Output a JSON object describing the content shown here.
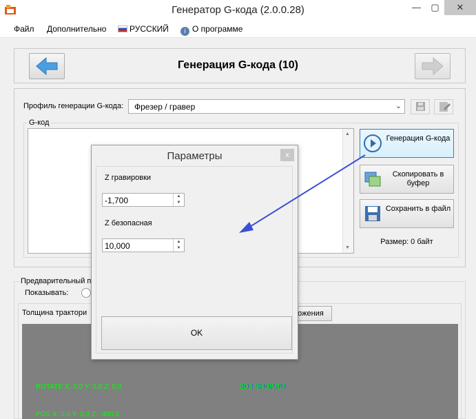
{
  "window": {
    "title": "Генератор G-кода (2.0.0.28)",
    "minimize": "—",
    "maximize": "▢",
    "close": "✕"
  },
  "menu": {
    "file": "Файл",
    "extra": "Дополнительно",
    "language": "РУССКИЙ",
    "about": "О программе"
  },
  "header": {
    "title": "Генерация G-кода (10)"
  },
  "profile": {
    "label": "Профиль генерации G-кода:",
    "selected": "Фрезер / гравер"
  },
  "gcode": {
    "group_label": "G-код",
    "generate_button": "Генерация G-кода",
    "copy_button": "Скопировать в буфер",
    "save_button": "Сохранить в файл",
    "size_label": "Размер: 0 байт"
  },
  "preview": {
    "group_label": "Предварительный пр",
    "show_label": "Показывать:",
    "thickness_label": "Толщина трактори",
    "tab_button": "ожения",
    "rotate_text": "ROTATE X: 0,0  Y: 0,0 Z: 0,0",
    "pos_text": "POS X: 0,0  Y: 0,0 Z: -300,0",
    "center_text": "2D3-SHOP.RU"
  },
  "dialog": {
    "title": "Параметры",
    "close": "x",
    "z_engrave_label": "Z гравировки",
    "z_engrave_value": "-1,700",
    "z_safe_label": "Z безопасная",
    "z_safe_value": "10,000",
    "ok_button": "OK"
  },
  "colors": {
    "accent": "#3c7fb1",
    "preview_bg": "#808080",
    "overlay_text": "#00ff00",
    "annotation_arrow": "#3a4fd6"
  }
}
